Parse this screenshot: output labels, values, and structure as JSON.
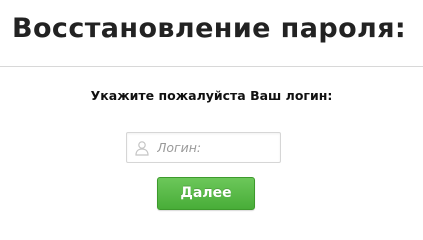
{
  "page": {
    "title": "Восстановление пароля:"
  },
  "form": {
    "prompt": "Укажите пожалуйста Ваш логин:",
    "login_input": {
      "placeholder": "Логин:",
      "value": ""
    },
    "submit_label": "Далее"
  },
  "icons": {
    "login_field_icon": "user-icon"
  },
  "colors": {
    "title_text": "#222222",
    "divider": "#d8d8d8",
    "button_green": "#4fb33f",
    "button_text": "#ffffff"
  }
}
